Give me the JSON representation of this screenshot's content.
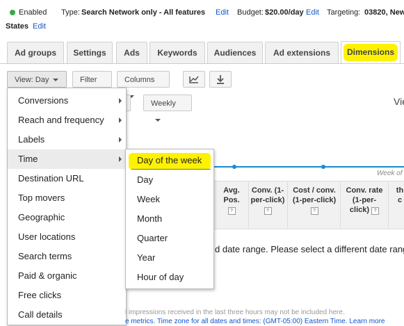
{
  "status": {
    "state": "Enabled",
    "type_label": "Type:",
    "type_value": "Search Network only - All features",
    "edit": "Edit",
    "budget_label": "Budget:",
    "budget_value": "$20.00/day",
    "targeting_label": "Targeting:",
    "targeting_value": "03820, New",
    "targeting_cont": "States"
  },
  "tabs": [
    "Ad groups",
    "Settings",
    "Ads",
    "Keywords",
    "Audiences",
    "Ad extensions",
    "Dimensions"
  ],
  "toolbar": {
    "view": "View: Day",
    "filter": "Filter",
    "columns": "Columns",
    "weekly": "Weekly",
    "view_link": "Vie"
  },
  "graph": {
    "week_label": "Week of"
  },
  "table_headers": [
    "Avg. Pos.",
    "Conv. (1-per-click)",
    "Cost / conv. (1-per-click)",
    "Conv. rate (1-per-click)",
    "th c"
  ],
  "messages": {
    "range": "d date range. Please select a different date rang",
    "impressions": "l impressions received in the last three hours may not be included here.",
    "timezone": "e metrics. Time zone for all dates and times: (GMT-05:00) Eastern Time.",
    "learn": "Learn more"
  },
  "menu": {
    "items": [
      "Conversions",
      "Reach and frequency",
      "Labels",
      "Time",
      "Destination URL",
      "Top movers",
      "Geographic",
      "User locations",
      "Search terms",
      "Paid & organic",
      "Free clicks",
      "Call details"
    ]
  },
  "submenu": {
    "items": [
      "Day of the week",
      "Day",
      "Week",
      "Month",
      "Quarter",
      "Year",
      "Hour of day"
    ]
  },
  "colors": {
    "highlight": "#fff200",
    "link": "#1155cc",
    "enabled": "#3aa843"
  }
}
